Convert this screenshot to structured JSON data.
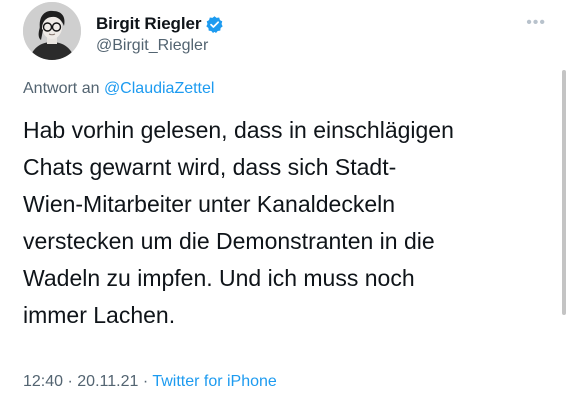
{
  "author": {
    "display_name": "Birgit Riegler",
    "handle": "@Birgit_Riegler",
    "avatar_icon": "profile-photo",
    "verified_icon": "verified-badge-icon",
    "verified_color": "#1d9bf0"
  },
  "more_icon": "more-options-icon",
  "reply": {
    "prefix": "Antwort an",
    "mention": "@ClaudiaZettel"
  },
  "tweet": {
    "lines": [
      "Hab vorhin gelesen, dass in einschlägigen",
      "Chats gewarnt wird, dass sich Stadt-",
      "Wien-Mitarbeiter unter Kanaldeckeln",
      "verstecken um die Demonstranten in die",
      "Wadeln zu impfen. Und ich muss noch",
      "immer Lachen."
    ]
  },
  "meta": {
    "time": "12:40",
    "separator": "·",
    "date": "20.11.21",
    "source": "Twitter for iPhone"
  },
  "colors": {
    "link": "#1d9bf0",
    "secondary_text": "#536471",
    "primary_text": "#0f1419"
  }
}
